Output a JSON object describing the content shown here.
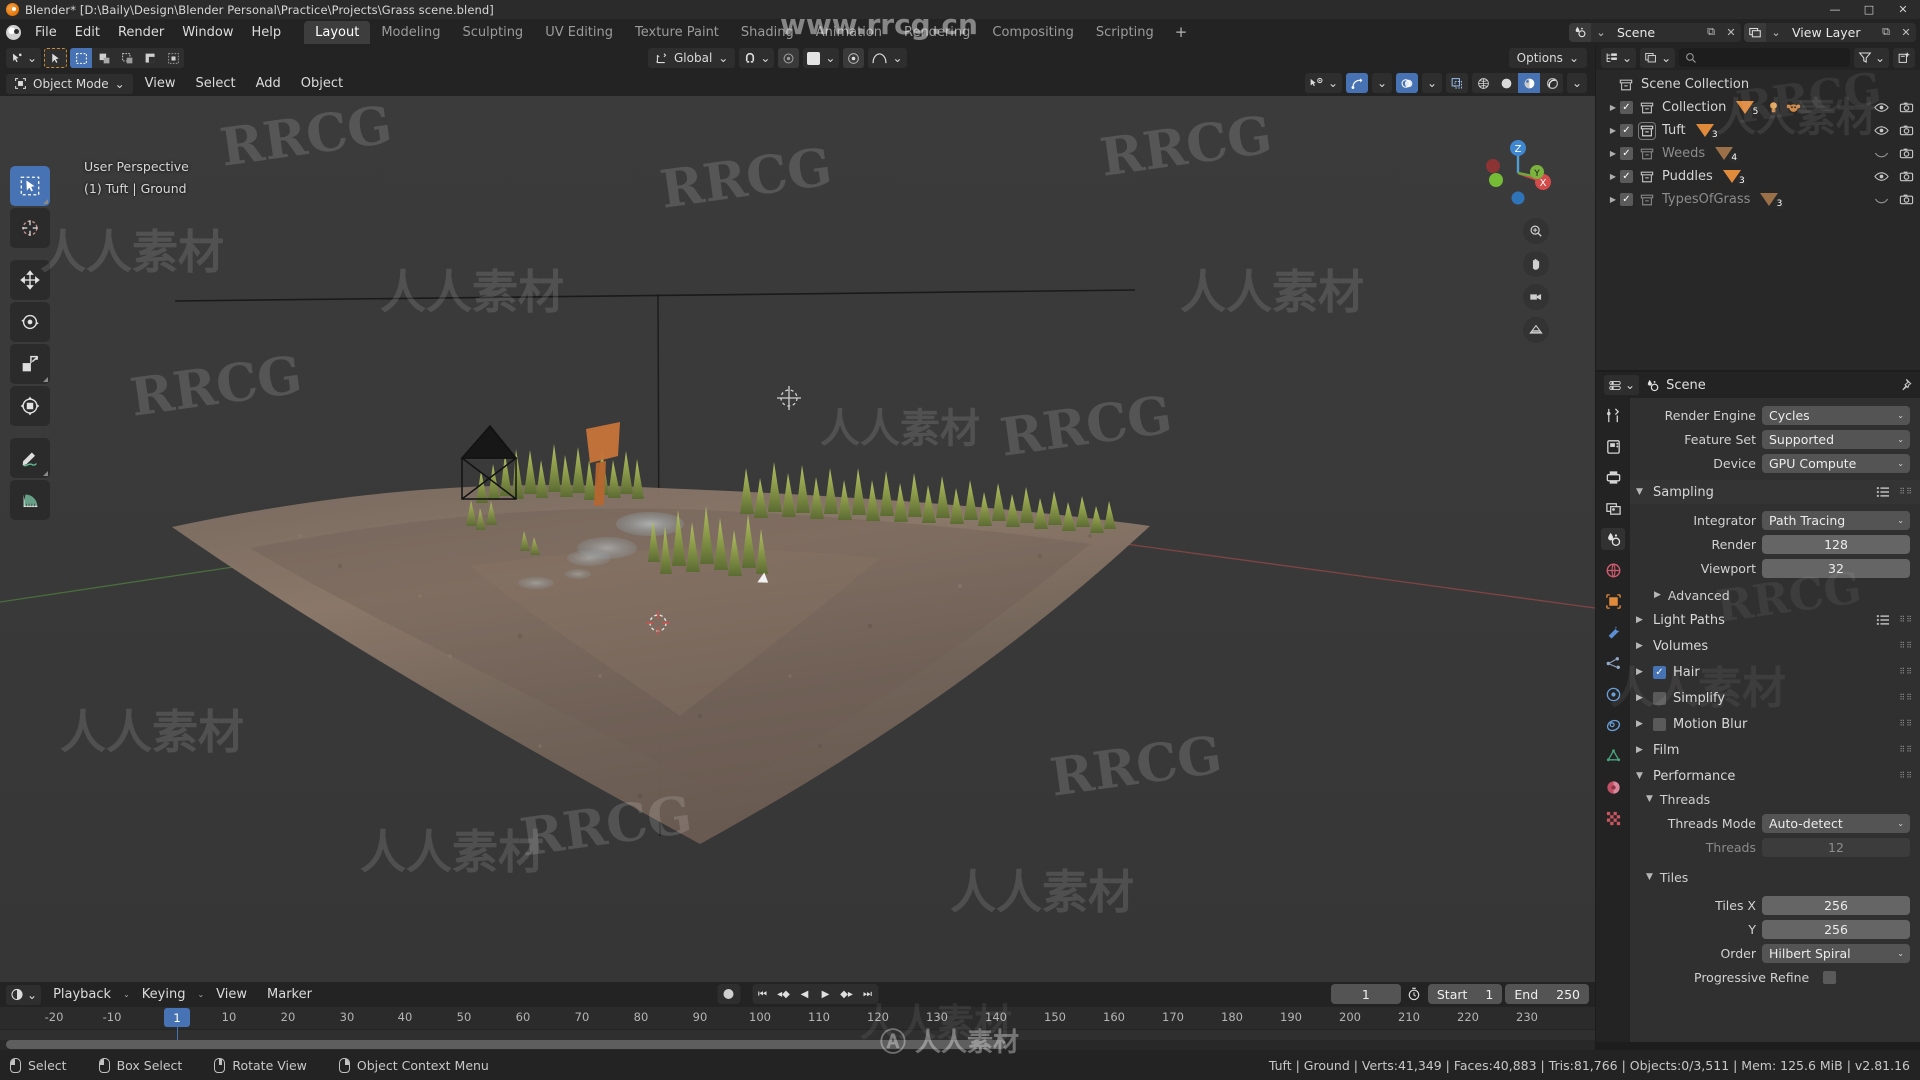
{
  "window": {
    "title": "Blender* [D:\\Baily\\Design\\Blender Personal\\Practice\\Projects\\Grass scene.blend]",
    "minimize": "—",
    "maximize": "□",
    "close": "✕"
  },
  "topbar": {
    "menus": [
      "File",
      "Edit",
      "Render",
      "Window",
      "Help"
    ],
    "workspaces": [
      {
        "label": "Layout",
        "active": true
      },
      {
        "label": "Modeling",
        "active": false
      },
      {
        "label": "Sculpting",
        "active": false
      },
      {
        "label": "UV Editing",
        "active": false
      },
      {
        "label": "Texture Paint",
        "active": false
      },
      {
        "label": "Shading",
        "active": false
      },
      {
        "label": "Animation",
        "active": false
      },
      {
        "label": "Rendering",
        "active": false
      },
      {
        "label": "Compositing",
        "active": false
      },
      {
        "label": "Scripting",
        "active": false
      }
    ],
    "add_workspace": "+",
    "scene_name": "Scene",
    "view_layer_name": "View Layer"
  },
  "viewport": {
    "mode": "Object Mode",
    "menus": [
      "View",
      "Select",
      "Add",
      "Object"
    ],
    "transform_orientation": "Global",
    "options_label": "Options",
    "overlay_line1": "User Perspective",
    "overlay_line2": "(1) Tuft | Ground",
    "gizmo_axes": {
      "z": "Z",
      "y": "Y",
      "x": "X"
    }
  },
  "outliner": {
    "display_mode": "view-layer",
    "search_placeholder": "",
    "root": "Scene Collection",
    "rows": [
      {
        "name": "Collection",
        "checked": true,
        "dim": false,
        "count": "5",
        "selected": false,
        "extra_icons": [
          "light-icon",
          "monkey-icon"
        ],
        "visible": true,
        "renderable": true
      },
      {
        "name": "Tuft",
        "checked": true,
        "dim": false,
        "count": "3",
        "selected": true,
        "extra_icons": [],
        "visible": true,
        "renderable": true
      },
      {
        "name": "Weeds",
        "checked": true,
        "dim": true,
        "count": "4",
        "selected": false,
        "extra_icons": [],
        "visible": false,
        "renderable": true
      },
      {
        "name": "Puddles",
        "checked": true,
        "dim": false,
        "count": "3",
        "selected": false,
        "extra_icons": [],
        "visible": true,
        "renderable": true
      },
      {
        "name": "TypesOfGrass",
        "checked": true,
        "dim": true,
        "count": "3",
        "selected": false,
        "extra_icons": [],
        "visible": false,
        "renderable": true
      }
    ]
  },
  "properties": {
    "breadcrumb": "Scene",
    "tabs": [
      "tool-icon",
      "render-icon",
      "output-icon",
      "view-layer-icon",
      "scene-icon",
      "world-icon",
      "object-icon",
      "modifier-icon",
      "particles-icon",
      "physics-icon",
      "constraint-icon",
      "data-icon",
      "material-icon",
      "texture-icon"
    ],
    "active_tab_index": 4,
    "fields": [
      {
        "label": "Render Engine",
        "value": "Cycles",
        "type": "dropdown"
      },
      {
        "label": "Feature Set",
        "value": "Supported",
        "type": "dropdown"
      },
      {
        "label": "Device",
        "value": "GPU Compute",
        "type": "dropdown"
      }
    ],
    "sampling": {
      "title": "Sampling",
      "integrator_label": "Integrator",
      "integrator_value": "Path Tracing",
      "render_label": "Render",
      "render_value": "128",
      "viewport_label": "Viewport",
      "viewport_value": "32",
      "advanced_label": "Advanced"
    },
    "panels": [
      {
        "label": "Light Paths",
        "type": "closed",
        "has_list": true
      },
      {
        "label": "Volumes",
        "type": "closed",
        "has_list": false
      },
      {
        "label": "Hair",
        "type": "closed",
        "checkbox": true,
        "checked": true
      },
      {
        "label": "Simplify",
        "type": "closed",
        "checkbox": true,
        "checked": false
      },
      {
        "label": "Motion Blur",
        "type": "closed",
        "checkbox": true,
        "checked": false
      },
      {
        "label": "Film",
        "type": "closed",
        "has_list": false
      }
    ],
    "performance": {
      "title": "Performance",
      "threads_title": "Threads",
      "threads_mode_label": "Threads Mode",
      "threads_mode_value": "Auto-detect",
      "threads_label": "Threads",
      "threads_value": "12",
      "tiles_title": "Tiles",
      "tiles_x_label": "Tiles X",
      "tiles_x_value": "256",
      "tiles_y_label": "Y",
      "tiles_y_value": "256",
      "order_label": "Order",
      "order_value": "Hilbert Spiral",
      "progressive_label": "Progressive Refine",
      "progressive_checked": false
    }
  },
  "timeline": {
    "menus": [
      "Playback",
      "Keying",
      "View",
      "Marker"
    ],
    "current_frame": "1",
    "start_label": "Start",
    "start_value": "1",
    "end_label": "End",
    "end_value": "250",
    "ticks": [
      "-20",
      "-10",
      "1",
      "10",
      "20",
      "30",
      "40",
      "50",
      "60",
      "70",
      "80",
      "90",
      "100",
      "110",
      "120",
      "130",
      "140",
      "150",
      "160",
      "170",
      "180",
      "190",
      "200",
      "210",
      "220",
      "230"
    ],
    "playhead_frame": "1"
  },
  "statusbar": {
    "hints": [
      {
        "button": "left",
        "label": "Select"
      },
      {
        "button": "left",
        "label": "Box Select"
      },
      {
        "button": "middle",
        "label": "Rotate View"
      },
      {
        "button": "right",
        "label": "Object Context Menu"
      }
    ],
    "stats": "Tuft | Ground | Verts:41,349 | Faces:40,883 | Tris:81,766 | Objects:0/3,511 | Mem: 125.6 MiB | v2.81.16"
  },
  "watermarks": {
    "site": "www.rrcg.cn",
    "brand": "RRCG",
    "cn": "人人素材"
  },
  "colors": {
    "accent_blue": "#4772b3",
    "orange": "#e08a3c",
    "panel_bg": "#303030",
    "header_bg": "#232323"
  }
}
